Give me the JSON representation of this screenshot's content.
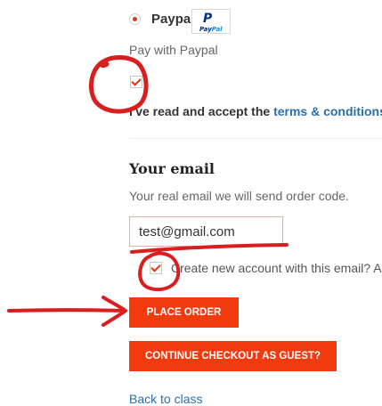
{
  "payment": {
    "option_label": "Paypal",
    "logo_text_pay": "Pay",
    "logo_text_pal": "Pal",
    "logo_mark": "P",
    "description": "Pay with Paypal"
  },
  "terms": {
    "prefix": "I've read and accept the ",
    "link": "terms & conditions.",
    "suffix": " *"
  },
  "email_section": {
    "title": "Your email",
    "description": "Your real email we will send order code.",
    "input_value": "test@gmail.com",
    "create_account_label": "Create new account with this email? Ac"
  },
  "buttons": {
    "place_order": "PLACE ORDER",
    "continue_guest": "CONTINUE CHECKOUT AS GUEST?"
  },
  "links": {
    "back": "Back to class"
  },
  "colors": {
    "accent": "#f23a0f",
    "link": "#2c6fa8",
    "annotation": "#d81e1e"
  }
}
